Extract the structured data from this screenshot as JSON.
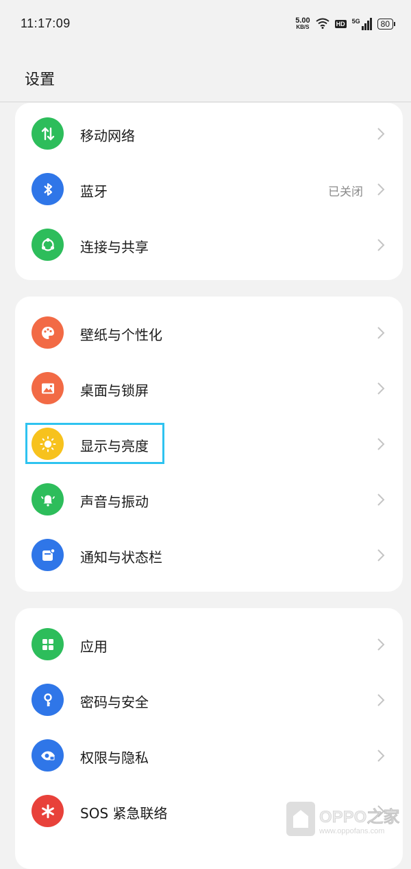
{
  "status_bar": {
    "time": "11:17:09",
    "net_speed_value": "5.00",
    "net_speed_unit": "KB/S",
    "hd_badge": "HD",
    "network_type": "5G",
    "battery": "80"
  },
  "header": {
    "title": "设置"
  },
  "sections": [
    {
      "items": [
        {
          "label": "移动网络",
          "icon": "mobile-data-icon",
          "color": "#2dbd5b"
        },
        {
          "label": "蓝牙",
          "value": "已关闭",
          "icon": "bluetooth-icon",
          "color": "#2f76e8"
        },
        {
          "label": "连接与共享",
          "icon": "share-connection-icon",
          "color": "#2dbd5b"
        }
      ]
    },
    {
      "items": [
        {
          "label": "壁纸与个性化",
          "icon": "palette-icon",
          "color": "#f26a45"
        },
        {
          "label": "桌面与锁屏",
          "icon": "image-icon",
          "color": "#f26a45"
        },
        {
          "label": "显示与亮度",
          "icon": "sun-icon",
          "color": "#f7c21d",
          "highlighted": true
        },
        {
          "label": "声音与振动",
          "icon": "bell-icon",
          "color": "#2dbd5b"
        },
        {
          "label": "通知与状态栏",
          "icon": "notification-icon",
          "color": "#2f76e8"
        }
      ]
    },
    {
      "items": [
        {
          "label": "应用",
          "icon": "apps-grid-icon",
          "color": "#2dbd5b"
        },
        {
          "label": "密码与安全",
          "icon": "key-icon",
          "color": "#2f76e8"
        },
        {
          "label": "权限与隐私",
          "icon": "privacy-eye-icon",
          "color": "#2f76e8"
        },
        {
          "label": "SOS 紧急联络",
          "icon": "asterisk-icon",
          "color": "#e8413a"
        }
      ]
    }
  ],
  "watermark": {
    "brand": "OPPO之家",
    "url": "www.oppofans.com"
  }
}
